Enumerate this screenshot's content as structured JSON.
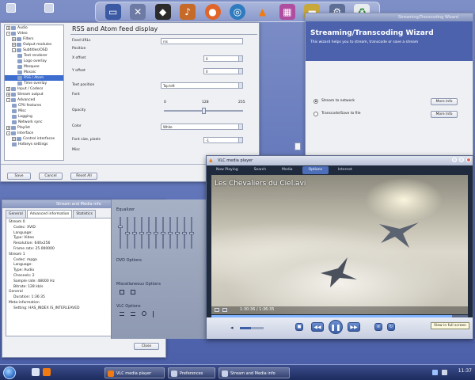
{
  "dock": {
    "icons": [
      "monitor-icon",
      "tools-icon",
      "linux-penguin-icon",
      "media-icon",
      "firefox-icon",
      "globe-icon",
      "vlc-cone-icon",
      "package-icon",
      "folder-icon",
      "network-icon",
      "trash-icon"
    ]
  },
  "prefs": {
    "title": "Preferences",
    "panel_title": "RSS and Atom feed display",
    "tree": [
      {
        "label": "Audio",
        "level": 0,
        "toggle": "+"
      },
      {
        "label": "Video",
        "level": 0,
        "toggle": "-"
      },
      {
        "label": "Filters",
        "level": 1,
        "toggle": "+"
      },
      {
        "label": "Output modules",
        "level": 1,
        "toggle": "+"
      },
      {
        "label": "Subtitles/OSD",
        "level": 1,
        "toggle": "-"
      },
      {
        "label": "Text renderer",
        "level": 2,
        "toggle": ""
      },
      {
        "label": "Logo overlay",
        "level": 2,
        "toggle": ""
      },
      {
        "label": "Marquee",
        "level": 2,
        "toggle": ""
      },
      {
        "label": "Mosaic",
        "level": 2,
        "toggle": ""
      },
      {
        "label": "RSS / Atom",
        "level": 2,
        "toggle": "",
        "selected": true
      },
      {
        "label": "Time overlay",
        "level": 2,
        "toggle": ""
      },
      {
        "label": "Input / Codecs",
        "level": 0,
        "toggle": "+"
      },
      {
        "label": "Stream output",
        "level": 0,
        "toggle": "+"
      },
      {
        "label": "Advanced",
        "level": 0,
        "toggle": "-"
      },
      {
        "label": "CPU features",
        "level": 1,
        "toggle": ""
      },
      {
        "label": "Misc",
        "level": 1,
        "toggle": ""
      },
      {
        "label": "Logging",
        "level": 1,
        "toggle": ""
      },
      {
        "label": "Network sync",
        "level": 1,
        "toggle": ""
      },
      {
        "label": "Playlist",
        "level": 0,
        "toggle": "+"
      },
      {
        "label": "Interface",
        "level": 0,
        "toggle": "-"
      },
      {
        "label": "Control interfaces",
        "level": 1,
        "toggle": "+"
      },
      {
        "label": "Hotkeys settings",
        "level": 1,
        "toggle": ""
      }
    ],
    "form": {
      "feed_urls_label": "Feed URLs",
      "feed_urls_value": "rss",
      "position_label": "Position",
      "x_offset_label": "X offset",
      "x_offset_value": "0",
      "y_offset_label": "Y offset",
      "y_offset_value": "0",
      "text_position_label": "Text position",
      "text_position_value": "Top-left",
      "font_label": "Font",
      "opacity_label": "Opacity",
      "opacity_min": "0",
      "opacity_mid": "128",
      "opacity_max": "255",
      "opacity_value": 0.5,
      "color_label": "Color",
      "color_value": "White",
      "font_size_label": "Font size, pixels",
      "font_size_value": "-1",
      "misc_label": "Misc"
    },
    "buttons": {
      "save": "Save",
      "cancel": "Cancel",
      "reset": "Reset All"
    }
  },
  "wizard": {
    "title_bar": "Streaming/Transcoding Wizard",
    "heading": "Streaming/Transcoding Wizard",
    "description": "This wizard helps you to stream, transcode or save a stream",
    "option1": "Stream to network",
    "option2": "Transcode/Save to file",
    "more_info": "More Info"
  },
  "info": {
    "title": "Stream and Media info",
    "tabs": [
      "General",
      "Advanced information",
      "Statistics"
    ],
    "active_tab": 1,
    "lines": [
      {
        "text": "Stream 0",
        "indent": false
      },
      {
        "text": "Codec: XVID",
        "indent": true
      },
      {
        "text": "Language:",
        "indent": true
      },
      {
        "text": "Type: Video",
        "indent": true
      },
      {
        "text": "Resolution: 640x256",
        "indent": true
      },
      {
        "text": "Frame rate: 25.000000",
        "indent": true
      },
      {
        "text": "Stream 1",
        "indent": false
      },
      {
        "text": "Codec: mpga",
        "indent": true
      },
      {
        "text": "Language:",
        "indent": true
      },
      {
        "text": "Type: Audio",
        "indent": true
      },
      {
        "text": "Channels: 2",
        "indent": true
      },
      {
        "text": "Sample rate: 48000 Hz",
        "indent": true
      },
      {
        "text": "Bitrate: 128 kb/s",
        "indent": true
      },
      {
        "text": "General",
        "indent": false
      },
      {
        "text": "Duration: 1:36:35",
        "indent": true
      },
      {
        "text": "Meta-information",
        "indent": false
      },
      {
        "text": "Setting: HAS_INDEX IS_INTERLEAVED",
        "indent": true
      }
    ],
    "close": "Close"
  },
  "ext": {
    "equalizer": "Equalizer",
    "dvd_options": "DVD Options",
    "misc_options": "Miscellaneous Options",
    "vlc_options": "VLC Options",
    "eq_levels": [
      0.7,
      0.5,
      0.5,
      0.5,
      0.5,
      0.5,
      0.5,
      0.5,
      0.5,
      0.5,
      0.5
    ]
  },
  "vlc": {
    "title": "VLC media player",
    "tabs": [
      "Now Playing",
      "Search",
      "Media",
      "Options",
      "Internet"
    ],
    "active_tab": 3,
    "video_title": "Les Chevaliers du Ciel.avi",
    "time": "1:30:36 / 1:36:35",
    "progress": 0.938,
    "volume": 0.45,
    "fullscreen_tip": "View in full screen"
  },
  "taskbar": {
    "tasks": [
      "VLC media player",
      "Preferences",
      "Stream and Media info"
    ],
    "clock": "11:37"
  }
}
